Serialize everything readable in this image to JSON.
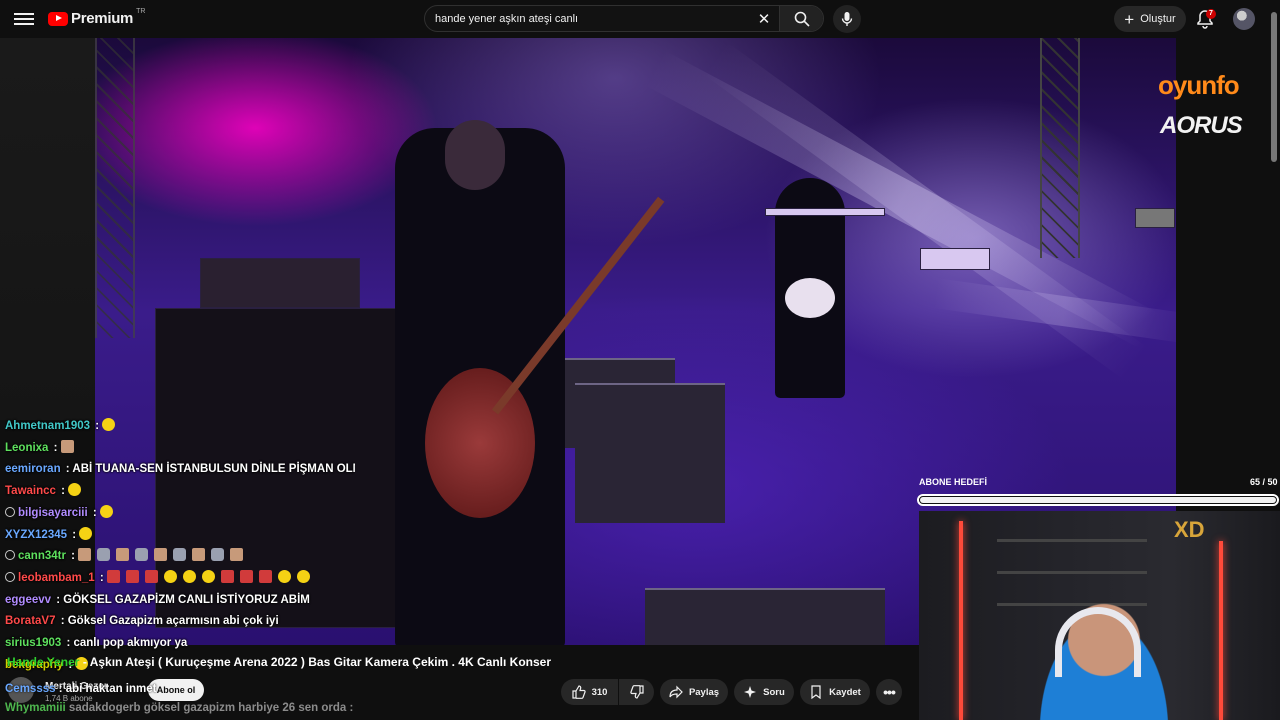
{
  "topbar": {
    "logo_text": "Premium",
    "logo_sup": "TR",
    "search_value": "hande yener aşkın ateşi canlı",
    "create_label": "Oluştur",
    "notif_count": "7",
    "icons": [
      "menu-icon",
      "youtube-logo",
      "clear-icon",
      "search-icon",
      "mic-icon",
      "plus-icon",
      "bell-icon",
      "avatar"
    ]
  },
  "overlay": {
    "sponsor1": "oyunfo",
    "sponsor2": "AORUS",
    "goal_label": "ABONE HEDEFİ",
    "goal_count": "65 / 50",
    "goal_progress": 1.0,
    "webcam_sign": "XD"
  },
  "chat": [
    {
      "user": "Ahmetnam1903",
      "msg": " :",
      "color": "#41c8c8",
      "emotes": [
        "yellow"
      ],
      "badge": false
    },
    {
      "user": "Leonixa",
      "msg": " :",
      "color": "#5ee05e",
      "emotes": [
        "face"
      ],
      "badge": false
    },
    {
      "user": "eemiroran",
      "msg": " : ABİ TUANA-SEN İSTANBULSUN DİNLE PİŞMAN OLM",
      "color": "#6aa8ff",
      "emotes": [],
      "badge": false
    },
    {
      "user": "Tawaincc",
      "msg": " :",
      "color": "#ff4a4a",
      "emotes": [
        "yellow"
      ],
      "badge": false
    },
    {
      "user": "bilgisayarciii",
      "msg": " :",
      "color": "#b18cff",
      "emotes": [
        "yellow"
      ],
      "badge": true
    },
    {
      "user": "XYZX12345",
      "msg": " :",
      "color": "#6aa8ff",
      "emotes": [
        "yellow"
      ],
      "badge": false
    },
    {
      "user": "cann34tr",
      "msg": " :",
      "color": "#5ee05e",
      "emotes": [
        "face",
        "rock",
        "face",
        "rock",
        "face",
        "rock",
        "face",
        "rock",
        "face"
      ],
      "badge": true
    },
    {
      "user": "leobambam_1",
      "msg": " :",
      "color": "#ff4a4a",
      "emotes": [
        "train",
        "train",
        "train",
        "yellow",
        "yellow",
        "yellow",
        "train",
        "train",
        "train",
        "yellow",
        "yellow"
      ],
      "badge": true
    },
    {
      "user": "eggeevv",
      "msg": " : GÖKSEL GAZAPİZM CANLI İSTİYORUZ ABİM",
      "color": "#b18cff",
      "emotes": [],
      "badge": false
    },
    {
      "user": "BorataV7",
      "msg": " : Göksel Gazapizm açarmısın abi çok iyi",
      "color": "#ff4a4a",
      "emotes": [],
      "badge": false
    },
    {
      "user": "sirius1903",
      "msg": " : canlı pop akmıyor ya",
      "color": "#5ee05e",
      "emotes": [],
      "badge": false
    },
    {
      "user": "bekgraphy",
      "msg": " :",
      "color": "#d0d000",
      "emotes": [
        "yellow"
      ],
      "badge": false
    }
  ],
  "video_info": {
    "title_prefix": "Hande Yener",
    "title": " - Aşkın Ateşi ( Kuruçeşme Arena 2022 ) Bas Gitar Kamera Çekim . 4K Canlı Konser",
    "channel_name": "Mertali Gezer",
    "subs": "1,74 B abone",
    "subscribe_label": "Abone ol",
    "likes": "310",
    "share_label": "Paylaş",
    "ask_label": "Soru",
    "save_label": "Kaydet"
  },
  "chat_overlap": {
    "user": "Cemssss",
    "msg": " : abi haktan inmet",
    "user2": "Whymamiii",
    "msg2": "sadakdogerb göksel gazapizm harbiye 26 sen orda :"
  }
}
